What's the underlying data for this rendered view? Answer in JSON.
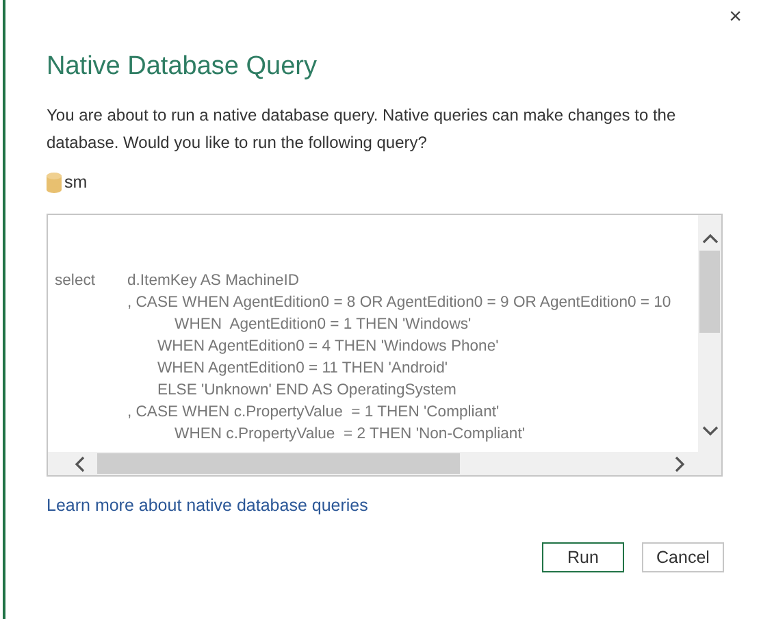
{
  "dialog": {
    "title": "Native Database Query",
    "message": "You are about to run a native database query. Native queries can make changes to the database. Would you like to run the following query?",
    "source": "sm",
    "close": "×"
  },
  "query": {
    "lines": [
      {
        "keyword": "select",
        "text": "d.ItemKey AS MachineID"
      },
      {
        "text": ", CASE WHEN AgentEdition0 = 8 OR AgentEdition0 = 9 OR AgentEdition0 = 10"
      },
      {
        "text": "           WHEN  AgentEdition0 = 1 THEN 'Windows'"
      },
      {
        "text": "       WHEN AgentEdition0 = 4 THEN 'Windows Phone'"
      },
      {
        "text": "       WHEN AgentEdition0 = 11 THEN 'Android'"
      },
      {
        "text": "       ELSE 'Unknown' END AS OperatingSystem"
      },
      {
        "text": ", CASE WHEN c.PropertyValue  = 1 THEN 'Compliant'"
      },
      {
        "text": "           WHEN c.PropertyValue  = 2 THEN 'Non-Compliant'"
      }
    ]
  },
  "link": "Learn more about native database queries",
  "buttons": [
    {
      "label": "Run",
      "kind": "primary"
    },
    {
      "label": "Cancel",
      "kind": "secondary"
    }
  ]
}
